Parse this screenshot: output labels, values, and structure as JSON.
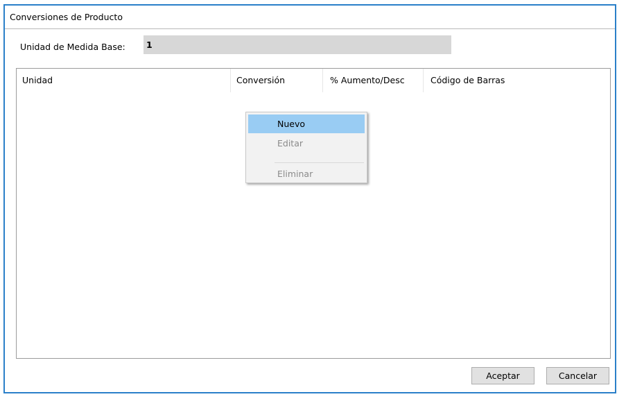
{
  "window": {
    "title": "Conversiones de Producto"
  },
  "base_unit": {
    "label": "Unidad de Medida Base:",
    "value": "1"
  },
  "table": {
    "columns": [
      "Unidad",
      "Conversión",
      "% Aumento/Desc",
      "Código de Barras"
    ],
    "rows": []
  },
  "context_menu": {
    "items": [
      {
        "label": "Nuevo",
        "state": "highlighted"
      },
      {
        "label": "Editar",
        "state": "disabled"
      },
      {
        "label": "Eliminar",
        "state": "disabled"
      }
    ]
  },
  "buttons": {
    "accept": "Aceptar",
    "cancel": "Cancelar"
  },
  "colors": {
    "window_border": "#2a7fc9",
    "menu_highlight": "#99ccf3",
    "field_background": "#d7d7d7"
  }
}
